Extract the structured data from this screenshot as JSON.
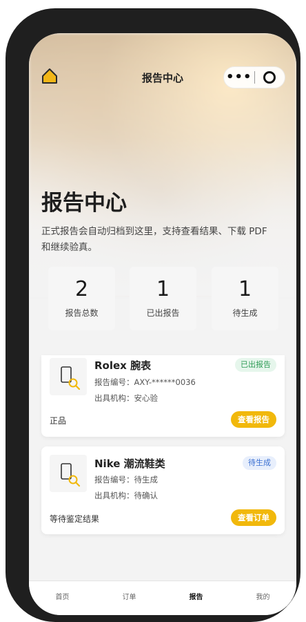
{
  "nav": {
    "title": "报告中心",
    "home_icon": "home-icon",
    "more_icon": "more-dots-icon",
    "close_icon": "close-circle-icon"
  },
  "hero": {
    "title": "报告中心",
    "description": "正式报告会自动归档到这里，支持查看结果、下载 PDF 和继续验真。"
  },
  "stats": [
    {
      "value": "2",
      "label": "报告总数"
    },
    {
      "value": "1",
      "label": "已出报告"
    },
    {
      "value": "1",
      "label": "待生成"
    }
  ],
  "reports": [
    {
      "title": "Rolex 腕表",
      "report_no": "报告编号：AXY-******0036",
      "issuer": "出具机构：安心验",
      "status": "已出报告",
      "status_color": "#2f9b56",
      "result": "正品",
      "action": "查看报告"
    },
    {
      "title": "Nike 潮流鞋类",
      "report_no": "报告编号：待生成",
      "issuer": "出具机构：待确认",
      "status": "待生成",
      "status_color": "#3a6fd1",
      "result": "等待鉴定结果",
      "action": "查看订单"
    }
  ],
  "tabbar": [
    {
      "label": "首页"
    },
    {
      "label": "订单"
    },
    {
      "label": "报告",
      "active": true
    },
    {
      "label": "我的"
    }
  ],
  "colors": {
    "accent": "#f1b80b",
    "home_icon": "#f2b617"
  }
}
